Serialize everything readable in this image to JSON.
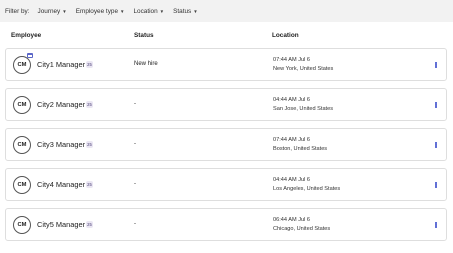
{
  "filters": {
    "label": "Filter by:",
    "items": [
      {
        "label": "Journey"
      },
      {
        "label": "Employee type"
      },
      {
        "label": "Location"
      },
      {
        "label": "Status"
      }
    ]
  },
  "table": {
    "headers": {
      "employee": "Employee",
      "status": "Status",
      "location": "Location"
    },
    "rows": [
      {
        "initials": "CM",
        "name": "City1 Manager",
        "badge": "25",
        "status": "New hire",
        "time": "07:44 AM Jul 6",
        "place": "New York, United States",
        "calendar_icon": true
      },
      {
        "initials": "CM",
        "name": "City2 Manager",
        "badge": "25",
        "status": "-",
        "time": "04:44 AM Jul 6",
        "place": "San Jose, United States",
        "calendar_icon": false
      },
      {
        "initials": "CM",
        "name": "City3 Manager",
        "badge": "25",
        "status": "-",
        "time": "07:44 AM Jul 6",
        "place": "Boston, United States",
        "calendar_icon": false
      },
      {
        "initials": "CM",
        "name": "City4 Manager",
        "badge": "25",
        "status": "-",
        "time": "04:44 AM Jul 6",
        "place": "Los Angeles, United States",
        "calendar_icon": false
      },
      {
        "initials": "CM",
        "name": "City5 Manager",
        "badge": "25",
        "status": "-",
        "time": "06:44 AM Jul 6",
        "place": "Chicago, United States",
        "calendar_icon": false
      }
    ]
  },
  "colors": {
    "accent": "#4a5bd0",
    "badge_bg": "#ebe7f3",
    "filter_bar_bg": "#f2f2f2"
  }
}
